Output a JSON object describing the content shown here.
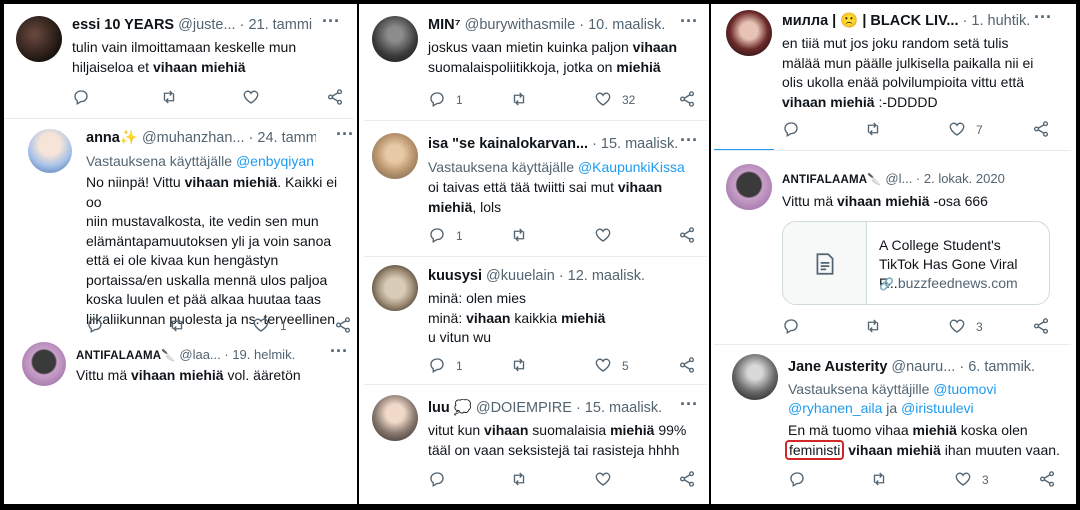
{
  "columns": [
    {
      "tweets": [
        {
          "name": "essi 10 YEARS",
          "meta": "@juste... · 21. tammik.",
          "body_html": "tulin vain ilmoittamaan keskelle mun\nhiljaiseloa et <b>vihaan miehiä</b>",
          "replies": "",
          "retweets": "",
          "likes": ""
        },
        {
          "name": "anna✨",
          "meta": "@muhanzhan... · 24. tammik.",
          "reply_prefix": "Vastauksena käyttäjälle",
          "reply_to": "@enbyqiyan",
          "body_html": "No niinpä! Vittu <b>vihaan miehiä</b>. Kaikki ei oo\nniin mustavalkosta, ite vedin sen mun\nelämäntapamuutoksen yli ja voin sanoa\nettä ei ole kivaa kun hengästyn\nportaissa/en uskalla mennä ulos paljoa\nkoska luulen et pää alkaa huutaa taas\nliikaliikunnan puolesta ja ns. terveellinen",
          "replies": "",
          "retweets": "",
          "likes": "1"
        },
        {
          "name": "ANTIFALAAMA🔪",
          "meta": "@laa... · 19. helmik.",
          "body_html": "Vittu mä <b>vihaan miehiä</b> vol. ääretön"
        }
      ]
    },
    {
      "tweets": [
        {
          "name": "MIN⁷",
          "meta": "@burywithasmile · 10. maalisk.",
          "body_html": "joskus vaan mietin kuinka paljon <b>vihaan</b>\nsuomalaispoliitikkoja, jotka on <b>miehiä</b>",
          "replies": "1",
          "retweets": "",
          "likes": "32"
        },
        {
          "name": "isa \"se kainalokarvan...",
          "meta": "· 15. maalisk.",
          "reply_prefix": "Vastauksena käyttäjälle",
          "reply_to": "@KaupunkiKissa",
          "body_html": "oi taivas että tää twiitti sai mut <b>vihaan</b>\n<b>miehiä</b>, lols",
          "replies": "1",
          "retweets": "",
          "likes": ""
        },
        {
          "name": "kuusysi",
          "meta": "@kuuelain · 12. maalisk.",
          "body_html": "minä: olen mies\nminä: <b>vihaan</b> kaikkia <b>miehiä</b>\nu vitun wu",
          "replies": "1",
          "retweets": "",
          "likes": "5"
        },
        {
          "name": "luu 💭",
          "meta": "@DOIEMPIRE · 15. maalisk.",
          "body_html": "vitut kun <b>vihaan</b> suomalaisia <b>miehiä</b> 99%\ntääl on vaan seksistejä tai rasisteja hhhh",
          "replies": "",
          "retweets": "",
          "likes": ""
        }
      ]
    },
    {
      "tweets": [
        {
          "name": "милла | 🙁 | BLACK LIV...",
          "meta": "· 1. huhtik.",
          "body_html": "en tiiä mut jos joku random setä tulis\nmälää mun päälle julkisella paikalla nii ei\nolis ukolla enää polvilumpioita vittu että\n<b>vihaan miehiä</b> :-DDDDD",
          "replies": "",
          "retweets": "",
          "likes": "7"
        },
        {
          "name": "ANTIFALAAMA🔪",
          "meta": "@l... · 2. lokak. 2020",
          "body_html": "Vittu mä <b>vihaan miehiä</b>  -osa 666",
          "card_title": "A College Student's TikTok Has Gone Viral F...",
          "card_domain": "buzzfeednews.com",
          "replies": "",
          "retweets": "",
          "likes": "3"
        },
        {
          "name": "Jane Austerity",
          "meta": "@nauru... · 6. tammik.",
          "reply_prefix": "Vastauksena käyttäjille",
          "reply_to": "@tuomovi",
          "reply_to2": "@ryhanen_aila",
          "reply_and": "ja",
          "reply_to3": "@iristuulevi",
          "body_line1_html": "En mä tuomo vihaa <b>miehiä</b> koska olen",
          "highlight_word": "feministi",
          "body_line2_rest_html": " <b>vihaan miehiä</b> ihan muuten vaan.",
          "replies": "",
          "retweets": "",
          "likes": "3"
        }
      ]
    }
  ],
  "colors": {
    "text": "#0f1419",
    "muted": "#536471",
    "link": "#1d9bf0",
    "highlight_border": "#d32626"
  }
}
